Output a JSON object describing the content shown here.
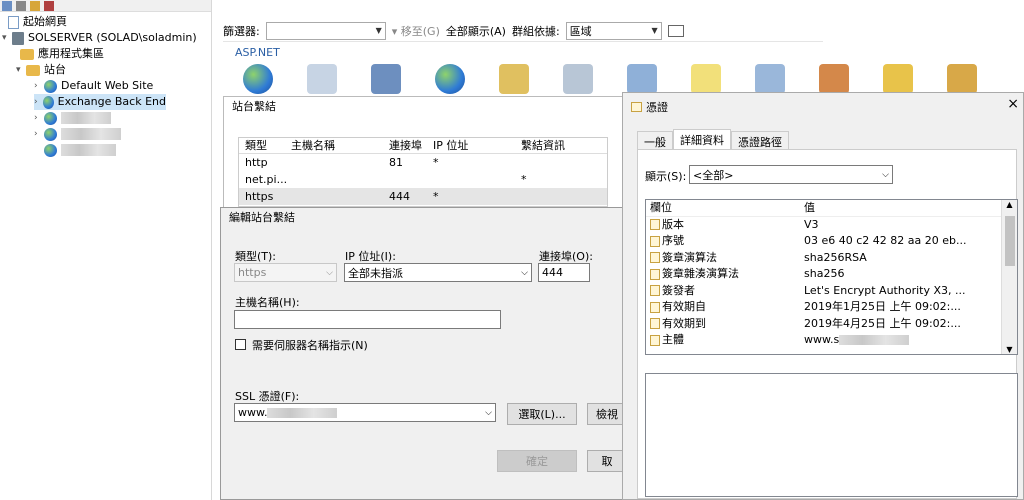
{
  "tree": {
    "start_page": "起始網頁",
    "server": "SOLSERVER (SOLAD\\soladmin)",
    "app_pools": "應用程式集區",
    "sites": "站台",
    "default_site": "Default Web Site",
    "exchange_site": "Exchange Back End"
  },
  "filter": {
    "label": "篩選器:",
    "go_label": "移至(G)",
    "show_all": "全部顯示(A)",
    "group_label": "群組依據:",
    "group_value": "區域"
  },
  "section": {
    "aspnet": "ASP.NET"
  },
  "bindings": {
    "title": "站台繫結",
    "headers": [
      "類型",
      "主機名稱",
      "連接埠",
      "IP 位址",
      "繫結資訊"
    ],
    "rows": [
      [
        "http",
        "",
        "81",
        "*",
        ""
      ],
      [
        "net.pi...",
        "",
        "",
        "",
        "*"
      ],
      [
        "https",
        "",
        "444",
        "*",
        ""
      ]
    ]
  },
  "edit": {
    "title": "編輯站台繫結",
    "type_label": "類型(T):",
    "type_value": "https",
    "ip_label": "IP 位址(I):",
    "ip_value": "全部未指派",
    "port_label": "連接埠(O):",
    "port_value": "444",
    "host_label": "主機名稱(H):",
    "host_value": "",
    "sni_label": "需要伺服器名稱指示(N)",
    "ssl_label": "SSL 憑證(F):",
    "ssl_value": "www.",
    "select_btn": "選取(L)...",
    "view_btn": "檢視",
    "ok_btn": "確定",
    "cancel_btn": "取"
  },
  "cert": {
    "title": "憑證",
    "close": "×",
    "tabs": [
      "一般",
      "詳細資料",
      "憑證路徑"
    ],
    "show_label": "顯示(S):",
    "show_value": "<全部>",
    "col_field": "欄位",
    "col_value": "值",
    "fields": [
      [
        "版本",
        "V3"
      ],
      [
        "序號",
        "03 e6 40 c2 42 82 aa 20 eb..."
      ],
      [
        "簽章演算法",
        "sha256RSA"
      ],
      [
        "簽章雜湊演算法",
        "sha256"
      ],
      [
        "簽發者",
        "Let's Encrypt Authority X3, ..."
      ],
      [
        "有效期自",
        "2019年1月25日 上午 09:02:..."
      ],
      [
        "有效期到",
        "2019年4月25日 上午 09:02:..."
      ],
      [
        "主體",
        "www.s"
      ]
    ]
  }
}
